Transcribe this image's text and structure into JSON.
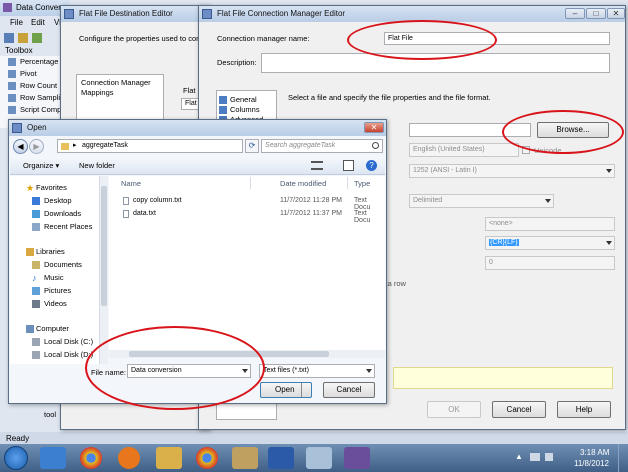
{
  "vs": {
    "title": "Data Conver",
    "menu": [
      "File",
      "Edit",
      "Vi"
    ],
    "toolbox_label": "Toolbox",
    "toolbox_items": [
      "Percentage",
      "Pivot",
      "Row Count",
      "Row Sampli",
      "Script Comp"
    ],
    "tool_label": "tool",
    "status": "Ready"
  },
  "dest": {
    "title": "Flat File Destination Editor",
    "desc": "Configure the properties used to conn",
    "flat_label": "Flat F",
    "flat_value": "Flat F",
    "mappings_list": [
      "Connection Manager",
      "Mappings"
    ]
  },
  "conn": {
    "title": "Flat File Connection Manager Editor",
    "name_label": "Connection manager name:",
    "name_value": "Flat File",
    "desc_label": "Description:",
    "nav": [
      "General",
      "Columns",
      "Advanced"
    ],
    "instruction": "Select a file and specify the file properties and the file format.",
    "browse": "Browse...",
    "locale": "English (United States)",
    "unicode": "Unicode",
    "codepage": "1252  (ANSI - Latin I)",
    "format": "Delimited",
    "text_qualifier": "<none>",
    "header_delimiter": "{CR}{LF}",
    "header_skip": "0",
    "data_row_text": "t data row",
    "ok": "OK",
    "cancel": "Cancel",
    "help": "Help",
    "controls": [
      "–",
      "□",
      "✕"
    ]
  },
  "open": {
    "title": "Open",
    "path_arrow": "▸",
    "path": "aggregateTask",
    "search_placeholder": "Search aggregateTask",
    "organize": "Organize ▾",
    "new_folder": "New folder",
    "columns": [
      "Name",
      "Date modified",
      "Type"
    ],
    "files": [
      {
        "name": "copy column.txt",
        "date": "11/7/2012 11:28 PM",
        "type": "Text Docu"
      },
      {
        "name": "data.txt",
        "date": "11/7/2012 11:37 PM",
        "type": "Text Docu"
      }
    ],
    "nav": [
      {
        "label": "Favorites",
        "head": true
      },
      {
        "label": "Desktop"
      },
      {
        "label": "Downloads"
      },
      {
        "label": "Recent Places"
      },
      {
        "label": "Libraries",
        "head": true
      },
      {
        "label": "Documents"
      },
      {
        "label": "Music"
      },
      {
        "label": "Pictures"
      },
      {
        "label": "Videos"
      },
      {
        "label": "Computer",
        "head": true
      },
      {
        "label": "Local Disk (C:)"
      },
      {
        "label": "Local Disk (D:)"
      }
    ],
    "file_name_label": "File name:",
    "file_name": "Data conversion",
    "file_type": "Text files (*.txt)",
    "open_btn": "Open",
    "cancel_btn": "Cancel"
  },
  "taskbar": {
    "time": "3:18 AM",
    "date": "11/8/2012"
  },
  "colors": {
    "annotation": "#d8141a",
    "start": "#2a72c4",
    "selection": "#3399ff"
  }
}
